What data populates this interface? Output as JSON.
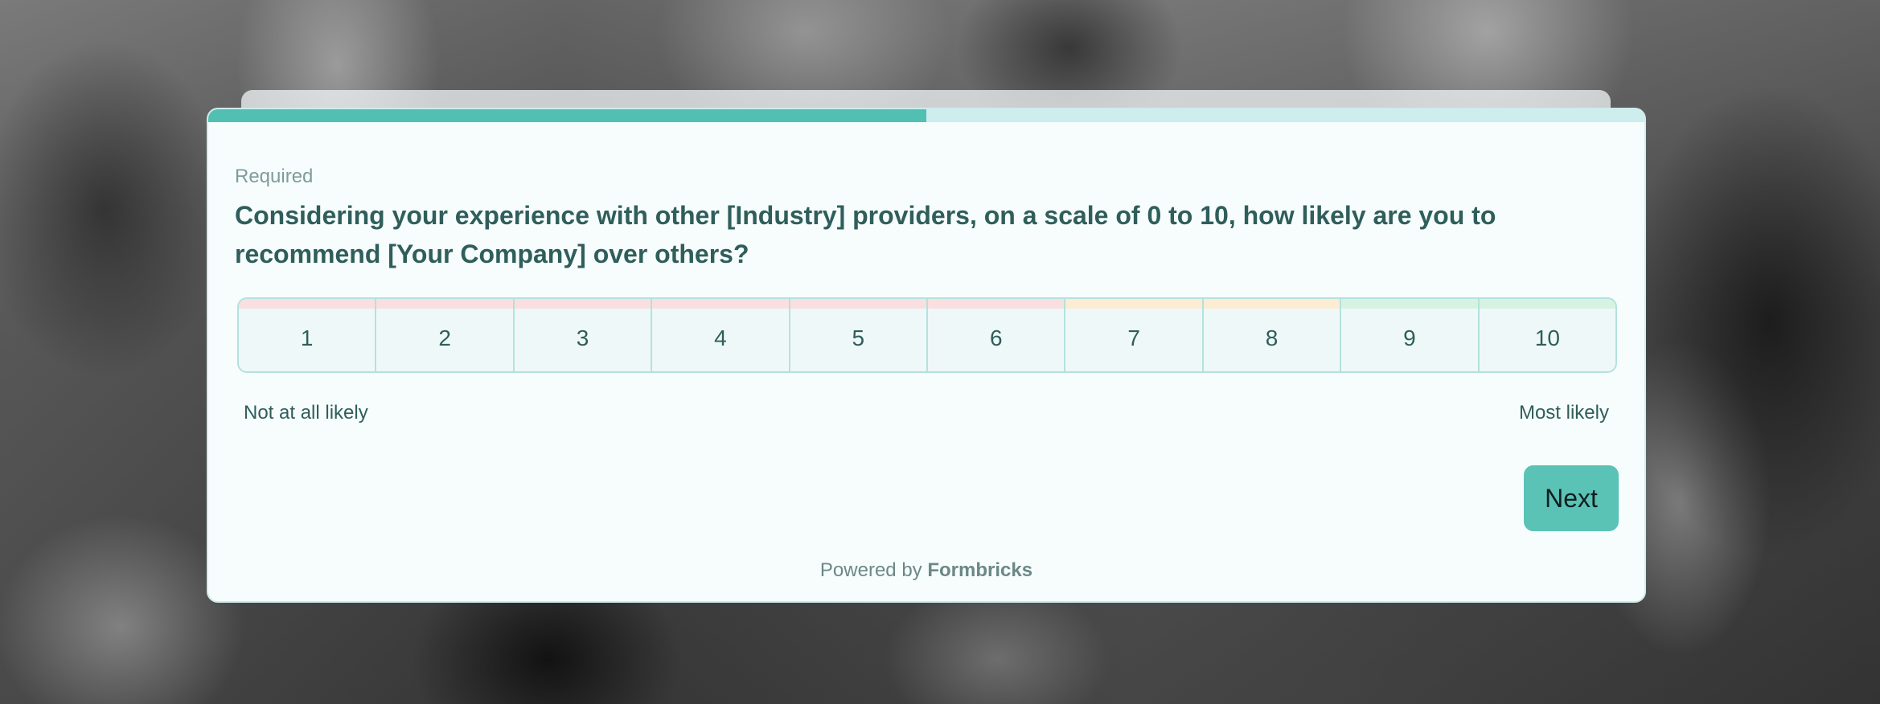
{
  "survey": {
    "progress": 0.5,
    "required_label": "Required",
    "question": "Considering your experience with other [Industry] providers, on a scale of 0 to 10, how likely are you to recommend [Your Company] over others?",
    "scale": [
      {
        "label": "1",
        "band_color": "#f9dfe0"
      },
      {
        "label": "2",
        "band_color": "#f9dfe0"
      },
      {
        "label": "3",
        "band_color": "#f9dfe0"
      },
      {
        "label": "4",
        "band_color": "#f9dfe0"
      },
      {
        "label": "5",
        "band_color": "#f9dfe0"
      },
      {
        "label": "6",
        "band_color": "#f9dfe0"
      },
      {
        "label": "7",
        "band_color": "#fbecd3"
      },
      {
        "label": "8",
        "band_color": "#fbecd3"
      },
      {
        "label": "9",
        "band_color": "#d6f3e2"
      },
      {
        "label": "10",
        "band_color": "#d6f3e2"
      }
    ],
    "lower_label": "Not at all likely",
    "upper_label": "Most likely",
    "next_label": "Next",
    "powered_by_prefix": "Powered by",
    "powered_by_brand": "Formbricks"
  },
  "colors": {
    "accent": "#52bfb3",
    "button": "#5bc2b6",
    "question_text": "#2f5e5b",
    "card_background": "#f7fdfd"
  }
}
